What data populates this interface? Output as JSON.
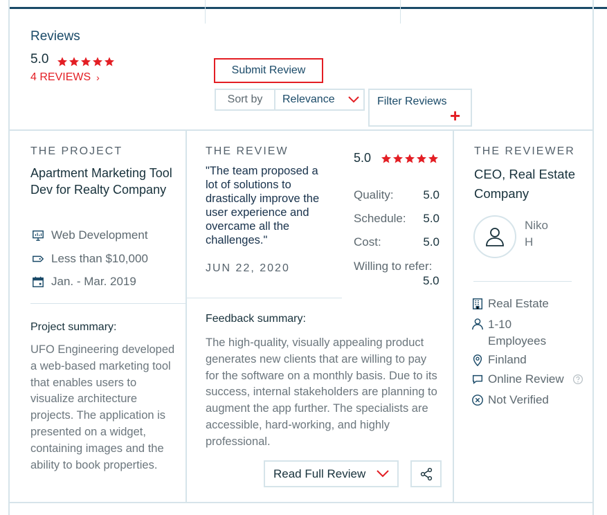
{
  "header": {
    "title": "Reviews",
    "rating": "5.0",
    "reviews_count_label": "4 REVIEWS",
    "submit_label": "Submit Review",
    "sort_label": "Sort by",
    "sort_value": "Relevance",
    "filter_label": "Filter Reviews"
  },
  "project": {
    "heading": "THE PROJECT",
    "title": "Apartment Marketing Tool Dev for Realty Company",
    "service": "Web Development",
    "budget": "Less than $10,000",
    "dates": "Jan. - Mar. 2019",
    "summary_heading": "Project summary:",
    "summary": "UFO Engineering developed a web-based marketing tool that enables users to visualize architecture projects. The application is presented on a widget, containing images and the ability to book properties."
  },
  "review": {
    "heading": "THE REVIEW",
    "quote": "\"The team proposed a lot of solutions to drastically improve the user experience and overcame all the challenges.\"",
    "date": "JUN 22, 2020",
    "overall": "5.0",
    "quality_label": "Quality:",
    "quality": "5.0",
    "schedule_label": "Schedule:",
    "schedule": "5.0",
    "cost_label": "Cost:",
    "cost": "5.0",
    "refer_label": "Willing to refer:",
    "refer": "5.0",
    "feedback_heading": "Feedback summary:",
    "feedback": "The high-quality, visually appealing product generates new clients that are willing to pay for the software on a monthly basis. Due to its success, internal stakeholders are planning to augment the app further. The specialists are accessible, hard-working, and highly professional.",
    "read_full_label": "Read Full Review"
  },
  "reviewer": {
    "heading": "THE REVIEWER",
    "title": "CEO, Real Estate Company",
    "name": "Niko H",
    "industry": "Real Estate",
    "employees": "1-10 Employees",
    "location": "Finland",
    "review_type": "Online Review",
    "verification": "Not Verified"
  },
  "colors": {
    "accent_red": "#e31e24",
    "brand_navy": "#1a4a68",
    "border": "#d6e4ea"
  }
}
